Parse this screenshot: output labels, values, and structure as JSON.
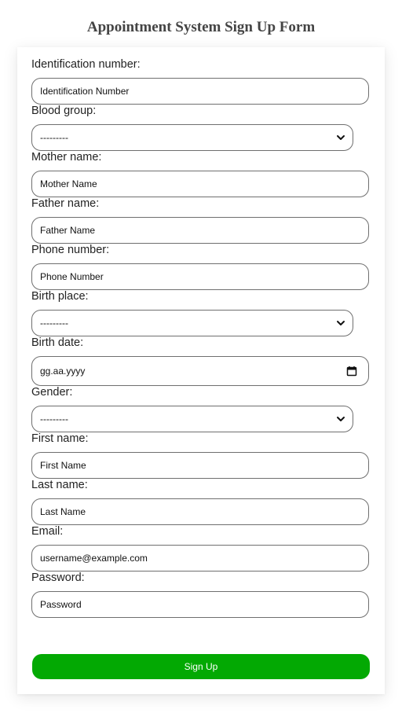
{
  "title": "Appointment System Sign Up Form",
  "fields": {
    "identification": {
      "label": "Identification number:",
      "placeholder": "Identification Number"
    },
    "blood_group": {
      "label": "Blood group:",
      "value": "---------"
    },
    "mother_name": {
      "label": "Mother name:",
      "placeholder": "Mother Name"
    },
    "father_name": {
      "label": "Father name:",
      "placeholder": "Father Name"
    },
    "phone_number": {
      "label": "Phone number:",
      "placeholder": "Phone Number"
    },
    "birth_place": {
      "label": "Birth place:",
      "value": "---------"
    },
    "birth_date": {
      "label": "Birth date:",
      "placeholder": "gg.aa.yyyy"
    },
    "gender": {
      "label": "Gender:",
      "value": "---------"
    },
    "first_name": {
      "label": "First name:",
      "placeholder": "First Name"
    },
    "last_name": {
      "label": "Last name:",
      "placeholder": "Last Name"
    },
    "email": {
      "label": "Email:",
      "placeholder": "username@example.com"
    },
    "password": {
      "label": "Password:",
      "placeholder": "Password"
    }
  },
  "submit_label": "Sign Up",
  "colors": {
    "submit_bg": "#03a903",
    "border": "#6f6f6f"
  }
}
